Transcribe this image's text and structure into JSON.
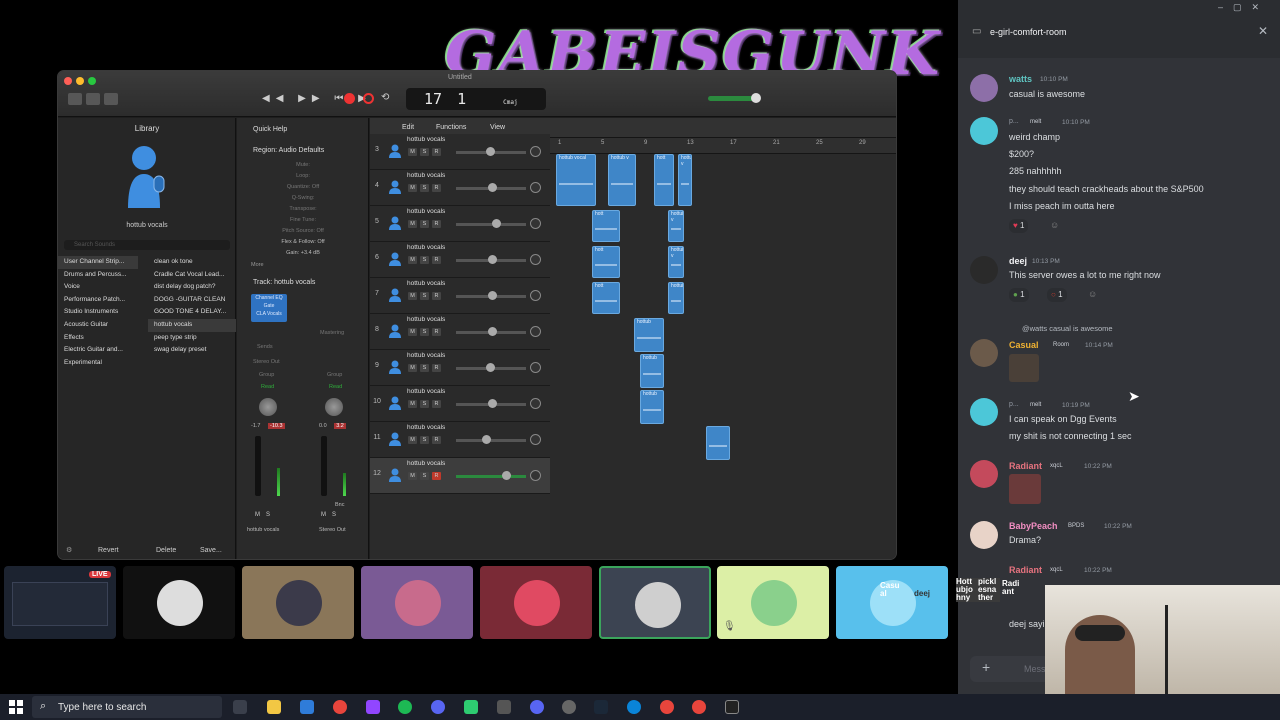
{
  "stream": {
    "logo_text": "GABEISGUNK",
    "live_badge": "LIVE"
  },
  "logic": {
    "window_title": "Untitled",
    "lcd": {
      "bar": "17",
      "beat": "1",
      "key": "Cmaj"
    },
    "library": {
      "title": "Library",
      "patch_name": "hottub vocals",
      "search_placeholder": "Search Sounds",
      "categories": [
        "User Channel Strip...",
        "Drums and Percuss...",
        "Voice",
        "Performance Patch...",
        "Studio Instruments",
        "Acoustic Guitar",
        "Effects",
        "Electric Guitar and...",
        "Experimental"
      ],
      "patches": [
        "clean ok tone",
        "Cradle Cat Vocal Lead...",
        "dist delay dog patch?",
        "DOGG -GUITAR CLEAN",
        "GOOD TONE 4 DELAY...",
        "hottub vocals",
        "peep type strip",
        "swag delay preset"
      ],
      "footer": {
        "revert": "Revert",
        "delete": "Delete",
        "save": "Save..."
      }
    },
    "inspector": {
      "quick_help": "Quick Help",
      "region": "Region: Audio Defaults",
      "params": [
        "Mute:",
        "Loop:",
        "Quantize: Off",
        "Q-Swing:",
        "Transpose:",
        "Fine Tune:",
        "Pitch Source: Off",
        "Flex & Follow: Off",
        "Gain: +3.4 dB"
      ],
      "more": "More",
      "track": "Track: hottub vocals",
      "plugins": [
        "Channel EQ",
        "Gate",
        "CLA Vocals"
      ],
      "labels": {
        "mastering": "Mastering",
        "sends": "Sends",
        "stereo_out": "Stereo Out",
        "group": "Group",
        "read": "Read"
      },
      "strip1": {
        "vals": [
          "-1.7",
          "-10.3"
        ],
        "name": "hottub vocals"
      },
      "strip2": {
        "vals": [
          "0.0",
          "3.2"
        ],
        "name": "Stereo Out",
        "bnc": "Bnc"
      },
      "ms": [
        "M",
        "S"
      ]
    },
    "menu": {
      "edit": "Edit",
      "functions": "Functions",
      "view": "View"
    },
    "ruler": [
      "1",
      "5",
      "9",
      "13",
      "17",
      "21",
      "25",
      "29"
    ],
    "tracks": [
      {
        "num": "3",
        "name": "hottub vocals"
      },
      {
        "num": "4",
        "name": "hottub vocals"
      },
      {
        "num": "5",
        "name": "hottub vocals"
      },
      {
        "num": "6",
        "name": "hottub vocals"
      },
      {
        "num": "7",
        "name": "hottub vocals"
      },
      {
        "num": "8",
        "name": "hottub vocals"
      },
      {
        "num": "9",
        "name": "hottub vocals"
      },
      {
        "num": "10",
        "name": "hottub vocals"
      },
      {
        "num": "11",
        "name": "hottub vocals"
      },
      {
        "num": "12",
        "name": "hottub vocals"
      }
    ],
    "track_buttons": [
      "M",
      "S",
      "R"
    ],
    "regions": [
      "hottub vocal",
      "hottub v",
      "hott",
      "hottub v",
      "hott",
      "hottub v",
      "hott",
      "hottub v",
      "hott",
      "hottub",
      "hottub",
      "hottub",
      "hottub"
    ]
  },
  "discord": {
    "channel": "e-girl-comfort-room",
    "messages": [
      {
        "user": "watts",
        "time": "10:10 PM",
        "color": "#5fc5c2",
        "lines": [
          "casual is awesome"
        ]
      },
      {
        "user": "p...",
        "tag": "melt",
        "time": "10:10 PM",
        "color": "#949ba4",
        "lines": [
          "weird champ",
          "$200?",
          "285 nahhhhh",
          "they should teach crackheads about the S&P500",
          "I miss peach im outta here"
        ],
        "reactions": [
          {
            "emoji": "heart",
            "count": "1"
          }
        ]
      },
      {
        "user": "deej",
        "time": "10:13 PM",
        "color": "#f2f3f5",
        "lines": [
          "This server owes a lot to me right now"
        ],
        "reactions": [
          {
            "emoji": "frog",
            "count": "1"
          },
          {
            "emoji": "ring",
            "count": "1"
          }
        ]
      },
      {
        "user": "Casual",
        "tag": "Room",
        "time": "10:14 PM",
        "color": "#f0b232",
        "reply": "@watts casual is awesome",
        "lines": []
      },
      {
        "user": "p...",
        "tag": "melt",
        "time": "10:19 PM",
        "color": "#949ba4",
        "lines": [
          "I can speak on Dgg Events",
          "my shit is  not connecting 1 sec"
        ]
      },
      {
        "user": "Radiant",
        "tag": "xqcL",
        "time": "10:22 PM",
        "color": "#e6737f",
        "lines": []
      },
      {
        "user": "BabyPeach",
        "tag": "BPDS",
        "time": "10:22 PM",
        "color": "#f28ec2",
        "lines": [
          "Drama?"
        ]
      },
      {
        "user": "Radiant",
        "tag": "xqcL",
        "time": "10:22 PM",
        "color": "#e6737f",
        "lines": []
      }
    ],
    "typing": "deej sayi",
    "message_placeholder": "Message",
    "overlay_names": [
      "Casu al",
      "deej",
      "Hott ubjo hny",
      "pickl esna ther",
      "Radi ant"
    ]
  },
  "taskbar": {
    "search_placeholder": "Type here to search"
  }
}
